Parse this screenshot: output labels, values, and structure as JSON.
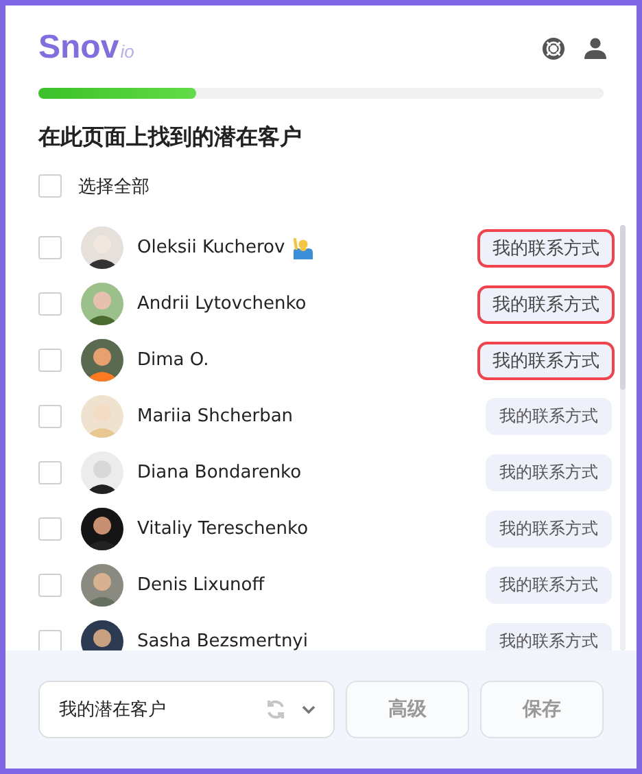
{
  "logo": {
    "main": "Snov",
    "suffix": "io"
  },
  "progress": {
    "level": 0.28
  },
  "title": "在此页面上找到的潜在客户",
  "select_all": {
    "label": "选择全部",
    "checked": false
  },
  "prospects": [
    {
      "name": "Oleksii Kucherov",
      "checked": false,
      "emoji": true,
      "badge": "我的联系方式",
      "highlighted": true
    },
    {
      "name": "Andrii Lytovchenko",
      "checked": false,
      "emoji": false,
      "badge": "我的联系方式",
      "highlighted": true
    },
    {
      "name": "Dima O.",
      "checked": false,
      "emoji": false,
      "badge": "我的联系方式",
      "highlighted": true
    },
    {
      "name": "Mariia Shcherban",
      "checked": false,
      "emoji": false,
      "badge": "我的联系方式",
      "highlighted": false
    },
    {
      "name": "Diana Bondarenko",
      "checked": false,
      "emoji": false,
      "badge": "我的联系方式",
      "highlighted": false
    },
    {
      "name": "Vitaliy Tereschenko",
      "checked": false,
      "emoji": false,
      "badge": "我的联系方式",
      "highlighted": false
    },
    {
      "name": "Denis Lixunoff",
      "checked": false,
      "emoji": false,
      "badge": "我的联系方式",
      "highlighted": false
    },
    {
      "name": "Sasha Bezsmertnyi",
      "checked": false,
      "emoji": false,
      "badge": "我的联系方式",
      "highlighted": false
    }
  ],
  "footer": {
    "list_select": "我的潜在客户",
    "buttons": [
      "高级",
      "保存"
    ]
  }
}
